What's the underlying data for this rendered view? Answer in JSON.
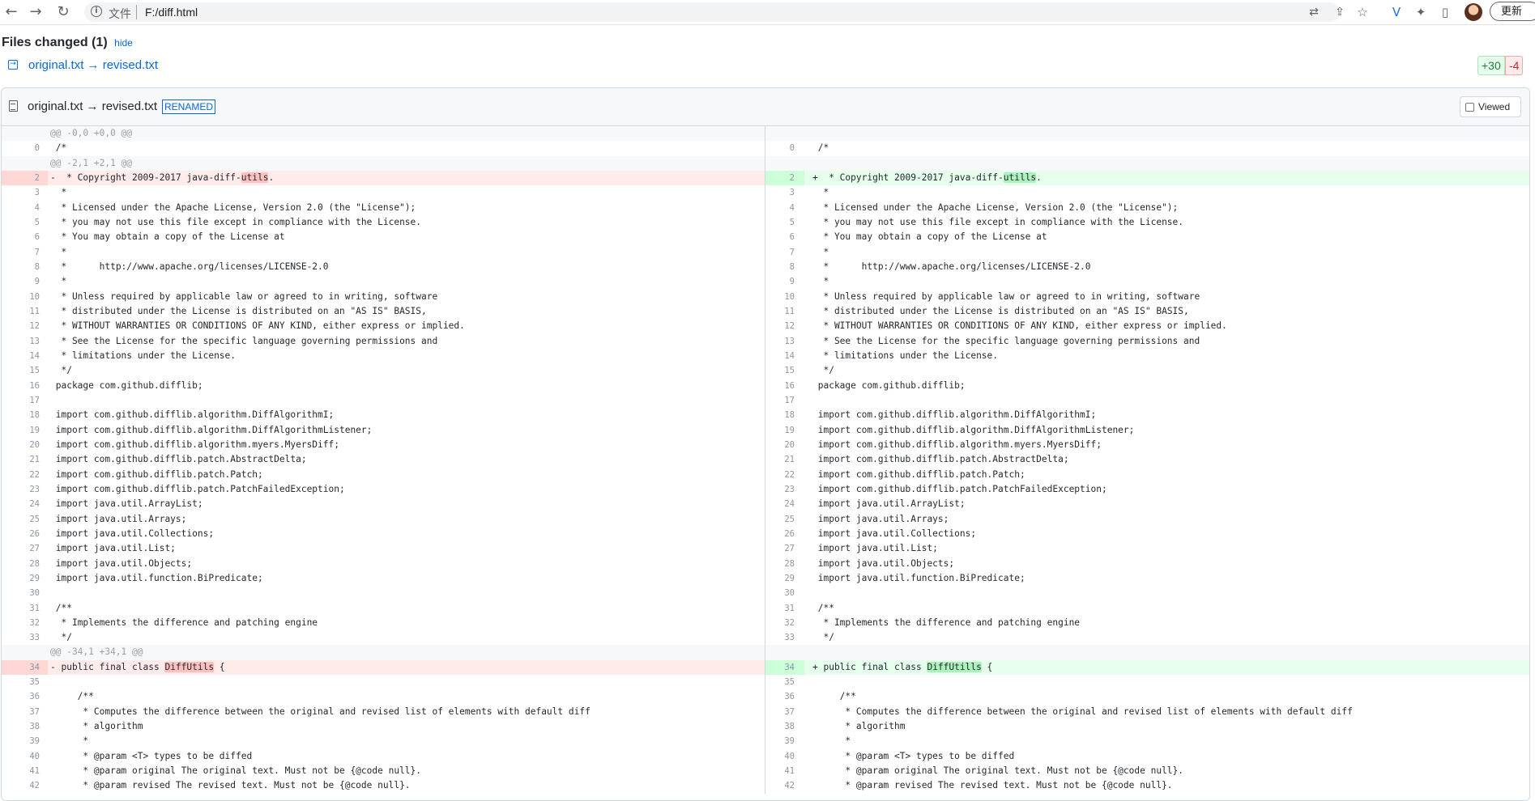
{
  "browser": {
    "back_icon": "back-arrow-icon",
    "forward_icon": "forward-arrow-icon",
    "reload_icon": "reload-icon",
    "address_label": "文件",
    "url": "F:/diff.html",
    "update_button": "更新"
  },
  "page": {
    "files_changed_title": "Files changed (1)",
    "hide_link": "hide",
    "file_link": "original.txt → revised.txt",
    "additions": "+30",
    "deletions": "-4"
  },
  "file": {
    "name": "original.txt → revised.txt",
    "badge": "RENAMED",
    "viewed_label": "Viewed"
  },
  "diff_rows": [
    {
      "type": "hunk",
      "left_text": "@@ -0,0 +0,0 @@",
      "right_text": ""
    },
    {
      "type": "ctx",
      "lnum": "0",
      "rnum": "0",
      "left": " /*",
      "right": " /*"
    },
    {
      "type": "hunk",
      "left_text": "@@ -2,1 +2,1 @@",
      "right_text": ""
    },
    {
      "type": "chg",
      "lnum": "2",
      "rnum": "2",
      "lpre": "-  * Copyright 2009-2017 java-diff-",
      "lhl": "utils",
      "lpost": ".",
      "rpre": "+  * Copyright 2009-2017 java-diff-",
      "rhl": "utills",
      "rpost": "."
    },
    {
      "type": "ctx",
      "lnum": "3",
      "rnum": "3",
      "left": "  *",
      "right": "  *"
    },
    {
      "type": "ctx",
      "lnum": "4",
      "rnum": "4",
      "left": "  * Licensed under the Apache License, Version 2.0 (the \"License\");",
      "right": "  * Licensed under the Apache License, Version 2.0 (the \"License\");"
    },
    {
      "type": "ctx",
      "lnum": "5",
      "rnum": "5",
      "left": "  * you may not use this file except in compliance with the License.",
      "right": "  * you may not use this file except in compliance with the License."
    },
    {
      "type": "ctx",
      "lnum": "6",
      "rnum": "6",
      "left": "  * You may obtain a copy of the License at",
      "right": "  * You may obtain a copy of the License at"
    },
    {
      "type": "ctx",
      "lnum": "7",
      "rnum": "7",
      "left": "  *",
      "right": "  *"
    },
    {
      "type": "ctx",
      "lnum": "8",
      "rnum": "8",
      "left": "  *      http://www.apache.org/licenses/LICENSE-2.0",
      "right": "  *      http://www.apache.org/licenses/LICENSE-2.0"
    },
    {
      "type": "ctx",
      "lnum": "9",
      "rnum": "9",
      "left": "  *",
      "right": "  *"
    },
    {
      "type": "ctx",
      "lnum": "10",
      "rnum": "10",
      "left": "  * Unless required by applicable law or agreed to in writing, software",
      "right": "  * Unless required by applicable law or agreed to in writing, software"
    },
    {
      "type": "ctx",
      "lnum": "11",
      "rnum": "11",
      "left": "  * distributed under the License is distributed on an \"AS IS\" BASIS,",
      "right": "  * distributed under the License is distributed on an \"AS IS\" BASIS,"
    },
    {
      "type": "ctx",
      "lnum": "12",
      "rnum": "12",
      "left": "  * WITHOUT WARRANTIES OR CONDITIONS OF ANY KIND, either express or implied.",
      "right": "  * WITHOUT WARRANTIES OR CONDITIONS OF ANY KIND, either express or implied."
    },
    {
      "type": "ctx",
      "lnum": "13",
      "rnum": "13",
      "left": "  * See the License for the specific language governing permissions and",
      "right": "  * See the License for the specific language governing permissions and"
    },
    {
      "type": "ctx",
      "lnum": "14",
      "rnum": "14",
      "left": "  * limitations under the License.",
      "right": "  * limitations under the License."
    },
    {
      "type": "ctx",
      "lnum": "15",
      "rnum": "15",
      "left": "  */",
      "right": "  */"
    },
    {
      "type": "ctx",
      "lnum": "16",
      "rnum": "16",
      "left": " package com.github.difflib;",
      "right": " package com.github.difflib;"
    },
    {
      "type": "ctx",
      "lnum": "17",
      "rnum": "17",
      "left": "",
      "right": ""
    },
    {
      "type": "ctx",
      "lnum": "18",
      "rnum": "18",
      "left": " import com.github.difflib.algorithm.DiffAlgorithmI;",
      "right": " import com.github.difflib.algorithm.DiffAlgorithmI;"
    },
    {
      "type": "ctx",
      "lnum": "19",
      "rnum": "19",
      "left": " import com.github.difflib.algorithm.DiffAlgorithmListener;",
      "right": " import com.github.difflib.algorithm.DiffAlgorithmListener;"
    },
    {
      "type": "ctx",
      "lnum": "20",
      "rnum": "20",
      "left": " import com.github.difflib.algorithm.myers.MyersDiff;",
      "right": " import com.github.difflib.algorithm.myers.MyersDiff;"
    },
    {
      "type": "ctx",
      "lnum": "21",
      "rnum": "21",
      "left": " import com.github.difflib.patch.AbstractDelta;",
      "right": " import com.github.difflib.patch.AbstractDelta;"
    },
    {
      "type": "ctx",
      "lnum": "22",
      "rnum": "22",
      "left": " import com.github.difflib.patch.Patch;",
      "right": " import com.github.difflib.patch.Patch;"
    },
    {
      "type": "ctx",
      "lnum": "23",
      "rnum": "23",
      "left": " import com.github.difflib.patch.PatchFailedException;",
      "right": " import com.github.difflib.patch.PatchFailedException;"
    },
    {
      "type": "ctx",
      "lnum": "24",
      "rnum": "24",
      "left": " import java.util.ArrayList;",
      "right": " import java.util.ArrayList;"
    },
    {
      "type": "ctx",
      "lnum": "25",
      "rnum": "25",
      "left": " import java.util.Arrays;",
      "right": " import java.util.Arrays;"
    },
    {
      "type": "ctx",
      "lnum": "26",
      "rnum": "26",
      "left": " import java.util.Collections;",
      "right": " import java.util.Collections;"
    },
    {
      "type": "ctx",
      "lnum": "27",
      "rnum": "27",
      "left": " import java.util.List;",
      "right": " import java.util.List;"
    },
    {
      "type": "ctx",
      "lnum": "28",
      "rnum": "28",
      "left": " import java.util.Objects;",
      "right": " import java.util.Objects;"
    },
    {
      "type": "ctx",
      "lnum": "29",
      "rnum": "29",
      "left": " import java.util.function.BiPredicate;",
      "right": " import java.util.function.BiPredicate;"
    },
    {
      "type": "ctx",
      "lnum": "30",
      "rnum": "30",
      "left": "",
      "right": ""
    },
    {
      "type": "ctx",
      "lnum": "31",
      "rnum": "31",
      "left": " /**",
      "right": " /**"
    },
    {
      "type": "ctx",
      "lnum": "32",
      "rnum": "32",
      "left": "  * Implements the difference and patching engine",
      "right": "  * Implements the difference and patching engine"
    },
    {
      "type": "ctx",
      "lnum": "33",
      "rnum": "33",
      "left": "  */",
      "right": "  */"
    },
    {
      "type": "hunk",
      "left_text": "@@ -34,1 +34,1 @@",
      "right_text": ""
    },
    {
      "type": "chg",
      "lnum": "34",
      "rnum": "34",
      "lpre": "- public final class ",
      "lhl": "DiffUtils",
      "lpost": " {",
      "rpre": "+ public final class ",
      "rhl": "DiffUtills",
      "rpost": " {"
    },
    {
      "type": "ctx",
      "lnum": "35",
      "rnum": "35",
      "left": "",
      "right": ""
    },
    {
      "type": "ctx",
      "lnum": "36",
      "rnum": "36",
      "left": "     /**",
      "right": "     /**"
    },
    {
      "type": "ctx",
      "lnum": "37",
      "rnum": "37",
      "left": "      * Computes the difference between the original and revised list of elements with default diff",
      "right": "      * Computes the difference between the original and revised list of elements with default diff"
    },
    {
      "type": "ctx",
      "lnum": "38",
      "rnum": "38",
      "left": "      * algorithm",
      "right": "      * algorithm"
    },
    {
      "type": "ctx",
      "lnum": "39",
      "rnum": "39",
      "left": "      *",
      "right": "      *"
    },
    {
      "type": "ctx",
      "lnum": "40",
      "rnum": "40",
      "left": "      * @param <T> types to be diffed",
      "right": "      * @param <T> types to be diffed"
    },
    {
      "type": "ctx",
      "lnum": "41",
      "rnum": "41",
      "left": "      * @param original The original text. Must not be {@code null}.",
      "right": "      * @param original The original text. Must not be {@code null}."
    },
    {
      "type": "ctx",
      "lnum": "42",
      "rnum": "42",
      "left": "      * @param revised The revised text. Must not be {@code null}.",
      "right": "      * @param revised The revised text. Must not be {@code null}."
    }
  ]
}
